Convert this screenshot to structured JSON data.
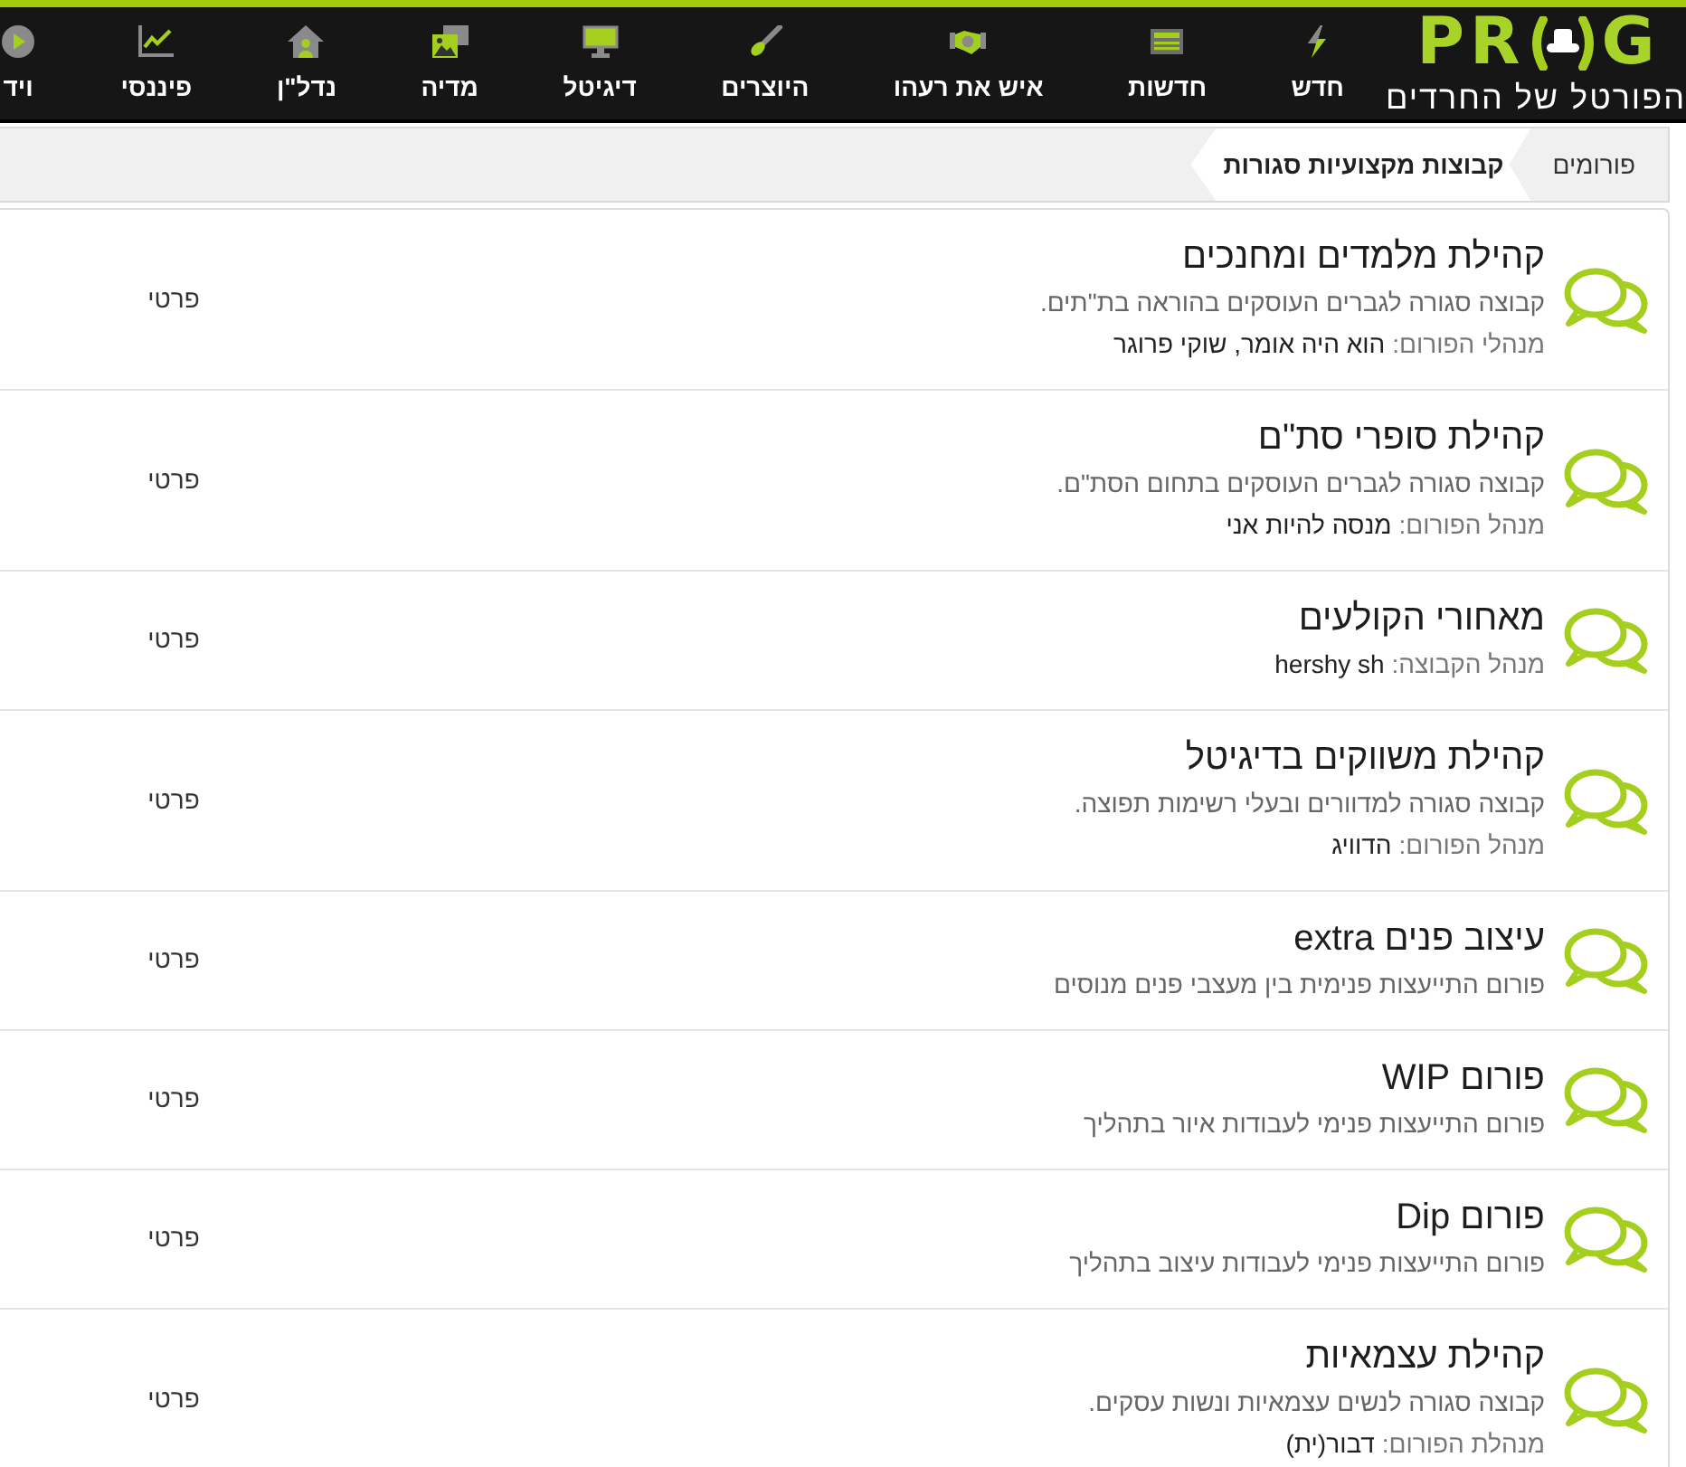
{
  "top_bar": {
    "logo": {
      "text_start": "PR",
      "text_end": "G",
      "tagline": "הפורטל של החרדים"
    },
    "nav_items": [
      {
        "label": "חדש"
      },
      {
        "label": "חדשות"
      },
      {
        "label": "איש את רעהו"
      },
      {
        "label": "היוצרים"
      },
      {
        "label": "דיגיטל"
      },
      {
        "label": "מדיה"
      },
      {
        "label": "נדל\"ן"
      },
      {
        "label": "פיננסי"
      },
      {
        "label": "ויד"
      }
    ]
  },
  "breadcrumb": [
    {
      "label": "פורומים",
      "current": false
    },
    {
      "label": "קבוצות מקצועיות סגורות",
      "current": true
    }
  ],
  "forums": [
    {
      "title": "קהילת מלמדים ומחנכים",
      "description": "קבוצה סגורה לגברים העוסקים בהוראה בת\"תים.",
      "moderator_label": "מנהלי הפורום:",
      "moderators": "הוא היה אומר, שוקי פרוגר",
      "access": "פרטי"
    },
    {
      "title": "קהילת סופרי סת\"ם",
      "description": "קבוצה סגורה לגברים העוסקים בתחום הסת\"ם.",
      "moderator_label": "מנהל הפורום:",
      "moderators": "מנסה להיות אני",
      "access": "פרטי"
    },
    {
      "title": "מאחורי הקולעים",
      "moderator_label": "מנהל הקבוצה:",
      "moderators": "hershy sh",
      "access": "פרטי"
    },
    {
      "title": "קהילת משווקים בדיגיטל",
      "description": "קבוצה סגורה למדוורים ובעלי רשימות תפוצה.",
      "moderator_label": "מנהל הפורום:",
      "moderators": "הדוויג",
      "access": "פרטי"
    },
    {
      "title": "עיצוב פנים extra",
      "description": "פורום התייעצות פנימית בין מעצבי פנים מנוסים",
      "access": "פרטי"
    },
    {
      "title": "פורום WIP",
      "description": "פורום התייעצות פנימי לעבודות איור בתהליך",
      "access": "פרטי"
    },
    {
      "title": "פורום Dip",
      "description": "פורום התייעצות פנימי לעבודות עיצוב בתהליך",
      "access": "פרטי"
    },
    {
      "title": "קהילת עצמאיות",
      "description": "קבוצה סגורה לנשים עצמאיות ונשות עסקים.",
      "moderator_label": "מנהלת הפורום:",
      "moderators": "דבור(ית)",
      "access": "פרטי"
    }
  ]
}
